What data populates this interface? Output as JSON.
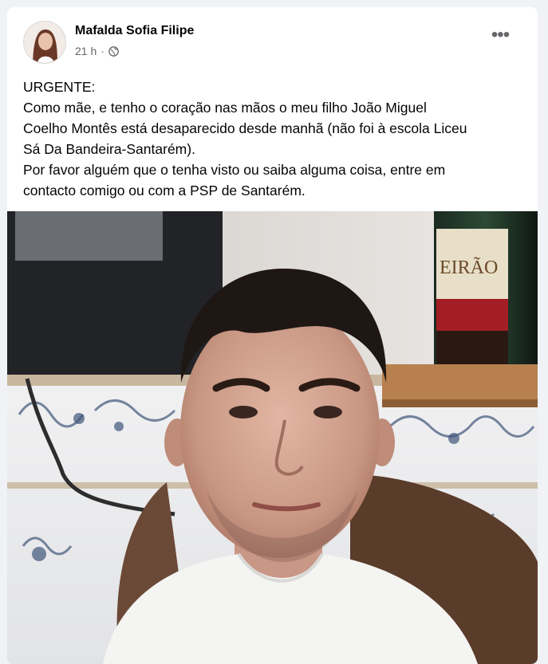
{
  "post": {
    "author": "Mafalda Sofia Filipe",
    "time": "21 h",
    "separator": "·",
    "privacy_icon": "globe-icon",
    "menu_icon": "more-options-icon",
    "text_lines": [
      "URGENTE:",
      "Como mãe, e tenho o coração nas mãos o meu filho João Miguel",
      "Coelho Montês está desaparecido desde manhã (não foi à escola Liceu",
      "Sá Da Bandeira-Santarém).",
      "Por favor alguém que o tenha visto ou saiba alguma coisa, entre em",
      "contacto comigo ou com a PSP de Santarém."
    ],
    "photo": {
      "bottle_label": "EIRÃO"
    }
  },
  "colors": {
    "background": "#f0f2f5",
    "card": "#ffffff",
    "author_text": "#050505",
    "meta_text": "#65676b"
  }
}
